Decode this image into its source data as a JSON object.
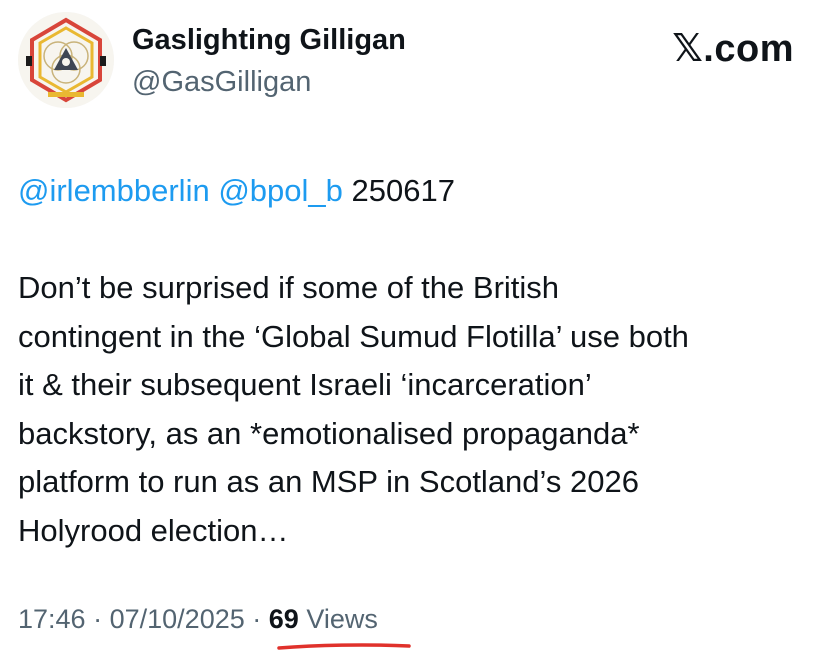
{
  "author": {
    "display_name": "Gaslighting Gilligan",
    "handle": "@GasGilligan",
    "avatar_icon": "geometric-emblem-avatar"
  },
  "brand": {
    "label": "𝕏.com"
  },
  "tweet": {
    "mentions": [
      "@irlembberlin",
      "@bpol_b"
    ],
    "ref_code": "250617",
    "paragraph_lines": [
      "Don’t be surprised if some of the British",
      "contingent in the ‘Global Sumud Flotilla’ use both",
      "it & their subsequent Israeli ‘incarceration’",
      "backstory, as an *emotionalised propaganda*",
      "platform to run as an MSP in Scotland’s 2026",
      "Holyrood election…"
    ]
  },
  "meta": {
    "time": "17:46",
    "separator": "·",
    "date": "07/10/2025",
    "views_count": "69",
    "views_label": "Views"
  },
  "colors": {
    "mention": "#1d9bf0",
    "text": "#0f1419",
    "secondary": "#536471",
    "annotation_underline": "#e0312b"
  }
}
